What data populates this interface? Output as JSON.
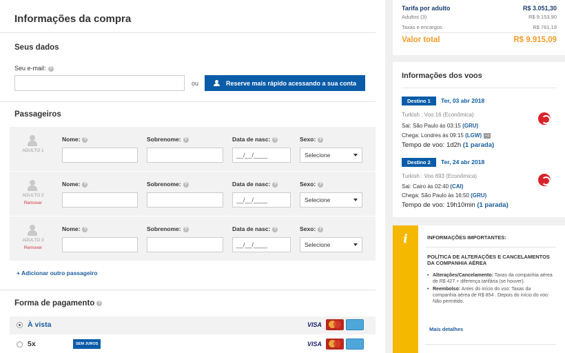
{
  "page": {
    "title": "Informações da compra"
  },
  "seus_dados": {
    "title": "Seus dados",
    "email_label": "Seu e-mail:",
    "email_value": "",
    "or_text": "ou",
    "login_button": "Reserve mais rápido acessando a sua conta"
  },
  "passageiros": {
    "title": "Passageiros",
    "labels": {
      "nome": "Nome:",
      "sobrenome": "Sobrenome:",
      "data_nasc": "Data de nasc:",
      "sexo": "Sexo:"
    },
    "date_placeholder": "__/__/____",
    "sexo_selected": "Selecione",
    "rows": [
      {
        "label": "ADULTO 1",
        "remove": ""
      },
      {
        "label": "ADULTO 2",
        "remove": "Remover"
      },
      {
        "label": "ADULTO 3",
        "remove": "Remover"
      }
    ],
    "add_passenger": "+ Adicionar outro passageiro"
  },
  "pagamento": {
    "title": "Forma de pagamento",
    "options": [
      {
        "label": "À vista",
        "badge": "",
        "selected": true
      },
      {
        "label": "5x",
        "badge": "SEM JUROS",
        "selected": false
      }
    ],
    "visa_text": "VISA"
  },
  "fare": {
    "per_adult_label": "Tarifa por adulto",
    "per_adult_value": "R$ 3.051,30",
    "adults_label": "Adultos (3)",
    "adults_value": "R$ 9.153,90",
    "taxes_label": "Taxas e encargos",
    "taxes_value": "R$ 761,19",
    "total_label": "Valor total",
    "total_value": "R$ 9.915,09"
  },
  "flights": {
    "title": "Informações dos voos",
    "items": [
      {
        "badge": "Destino 1",
        "date": "Ter, 03 abr 2018",
        "flight": "Turkish : Voo 16 (Econômica)",
        "sai_prefix": "Sai: ",
        "sai": "São Paulo às 03:15",
        "sai_code": "(GRU)",
        "chega_prefix": "Chega: ",
        "chega": "Londres às 09:15",
        "chega_code": "(LGW)",
        "plus_days": "+1",
        "tempo_prefix": "Tempo de voo: ",
        "tempo": "1d2h",
        "paradas": "(1 parada)"
      },
      {
        "badge": "Destino 2",
        "date": "Ter, 24 abr 2018",
        "flight": "Turkish : Voo 693 (Econômica)",
        "sai_prefix": "Sai: ",
        "sai": "Cairo às 02:40",
        "sai_code": "(CAI)",
        "chega_prefix": "Chega: ",
        "chega": "São Paulo às 16:50",
        "chega_code": "(GRU)",
        "plus_days": "",
        "tempo_prefix": "Tempo de voo: ",
        "tempo": "19h10min",
        "paradas": "(1 parada)"
      }
    ]
  },
  "info": {
    "heading": "INFORMAÇÕES IMPORTANTES:",
    "policy": "POLÍTICA DE ALTERAÇÕES E CANCELAMENTOS DA COMPANHIA AÉREA",
    "bullet1_label": "Alterações/Cancelamento:",
    "bullet1_text": " Taxas da companhia aérea de R$ 427 + diferença tarifária (se houver).",
    "bullet2_label": "Reembolso:",
    "bullet2_text": " Antes do início do voo: Taxas da companhia aérea de R$ 854 . Depois do início do voo: Não permitido.",
    "more": "Mais detalhes"
  },
  "colors": {
    "primary_blue": "#0a5ca8",
    "total_orange": "#f39c29",
    "info_yellow": "#f5b800",
    "remove_red": "#d0343a"
  }
}
